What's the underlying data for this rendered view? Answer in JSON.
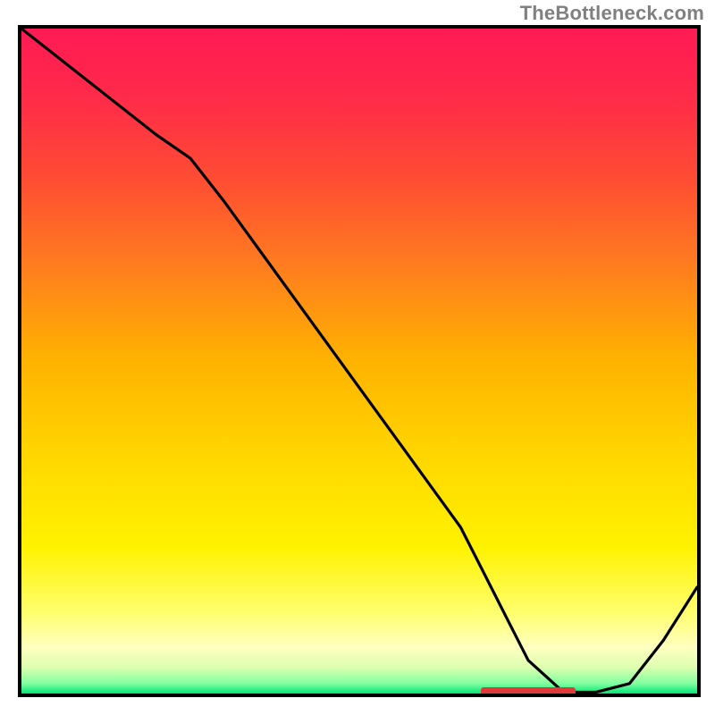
{
  "watermark": "TheBottleneck.com",
  "chart_data": {
    "type": "line",
    "title": "",
    "xlabel": "",
    "ylabel": "",
    "xlim": [
      0,
      100
    ],
    "ylim": [
      0,
      100
    ],
    "x": [
      0,
      5,
      10,
      15,
      20,
      25,
      30,
      35,
      40,
      45,
      50,
      55,
      60,
      65,
      68,
      70,
      72,
      75,
      80,
      82,
      85,
      90,
      95,
      100
    ],
    "y": [
      100,
      96,
      92,
      88,
      84,
      80.5,
      74,
      67,
      60,
      53,
      46,
      39,
      32,
      25,
      19,
      15,
      11,
      5,
      0.4,
      0.2,
      0.2,
      1.5,
      8,
      16
    ],
    "gradient_stops": [
      {
        "pos": 0.0,
        "color": "#ff1a54"
      },
      {
        "pos": 0.1,
        "color": "#ff2a4a"
      },
      {
        "pos": 0.22,
        "color": "#ff4a34"
      },
      {
        "pos": 0.35,
        "color": "#ff7a20"
      },
      {
        "pos": 0.5,
        "color": "#ffb300"
      },
      {
        "pos": 0.65,
        "color": "#ffd800"
      },
      {
        "pos": 0.78,
        "color": "#fff200"
      },
      {
        "pos": 0.88,
        "color": "#ffff70"
      },
      {
        "pos": 0.93,
        "color": "#ffffc0"
      },
      {
        "pos": 0.96,
        "color": "#dfffb0"
      },
      {
        "pos": 0.985,
        "color": "#80ffa0"
      },
      {
        "pos": 1.0,
        "color": "#00e676"
      }
    ],
    "marker": {
      "x_start": 68,
      "x_end": 82,
      "y": 0.4,
      "color": "#e03a3a"
    }
  }
}
